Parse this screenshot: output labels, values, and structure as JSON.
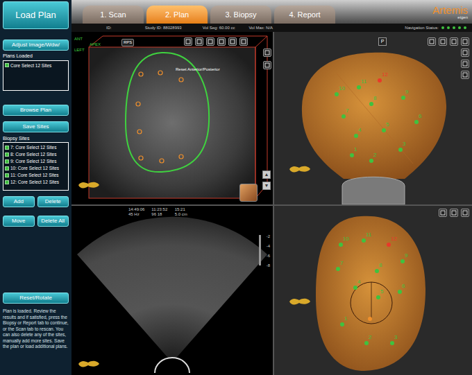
{
  "sidebar": {
    "load_button": "Load Plan",
    "adjust_button": "Adjust Image/Wdw/",
    "plans_label": "Plans Loaded",
    "plans": [
      {
        "label": "Core Select 12 Sites",
        "checked": true
      }
    ],
    "plan_buttons": [
      "Browse Plan",
      "Save Sites"
    ],
    "sites_label": "Biopsy Sites",
    "sites": [
      {
        "label": "7: Core Select 12 Sites",
        "checked": true
      },
      {
        "label": "8: Core Select 12 Sites",
        "checked": true
      },
      {
        "label": "9: Core Select 12 Sites",
        "checked": true
      },
      {
        "label": "10: Core Select 12 Sites",
        "checked": true
      },
      {
        "label": "11: Core Select 12 Sites",
        "checked": true
      },
      {
        "label": "12: Core Select 12 Sites",
        "checked": true
      }
    ],
    "site_buttons": [
      "Add",
      "Delete",
      "Move",
      "Delete All"
    ],
    "reset_button": "Reset/Rotate",
    "help_text": "Plan is loaded. Review the results and if satisfied, press the Biopsy or Report tab to continue, or the Scan tab to rescan. You can also delete any of the sites, manually add more sites. Save the plan or load additional plans."
  },
  "tabs": [
    {
      "label": "1. Scan",
      "selected": false
    },
    {
      "label": "2. Plan",
      "selected": true
    },
    {
      "label": "3. Biopsy",
      "selected": false
    },
    {
      "label": "4. Report",
      "selected": false
    }
  ],
  "logo": {
    "name": "Artemis",
    "sub": "eigen"
  },
  "info": {
    "id": "ID:",
    "study": "Study ID: 88028993",
    "vol_seg": "Vol Seg: 60.00 cc",
    "vol_max": "Vol Max: N/A",
    "nav_label": "Navigation Status:",
    "nav_dots": [
      {
        "on": true
      },
      {
        "on": true
      },
      {
        "on": true
      },
      {
        "on": true
      },
      {
        "on": true
      }
    ]
  },
  "scan_panel": {
    "orientation": [
      "ANT",
      "APEX",
      "LEFT"
    ],
    "overlay": "Reset Anterior/Posterior",
    "mode": "RPS",
    "arrows": [
      "▲",
      "▼"
    ]
  },
  "ultrasound": {
    "readout": [
      "14:49:06",
      "11:23:52",
      "15:21",
      "45 Hz",
      "96 18",
      "5.0 cm"
    ],
    "scale": [
      "-2",
      "-4",
      "-6",
      "-8"
    ]
  },
  "model_top": {
    "button": "P",
    "sites": [
      {
        "label": "1",
        "color": "#3fc23f"
      },
      {
        "label": "2",
        "color": "#3fc23f"
      },
      {
        "label": "3",
        "color": "#3fc23f"
      },
      {
        "label": "4",
        "color": "#3fc23f"
      },
      {
        "label": "5",
        "color": "#3fc23f"
      },
      {
        "label": "6",
        "color": "#3fc23f"
      },
      {
        "label": "7",
        "color": "#3fc23f"
      },
      {
        "label": "8",
        "color": "#3fc23f"
      },
      {
        "label": "9",
        "color": "#3fc23f"
      },
      {
        "label": "10",
        "color": "#3fc23f"
      },
      {
        "label": "11",
        "color": "#3fc23f"
      },
      {
        "label": "12",
        "color": "#e8392a"
      }
    ]
  },
  "model_bottom": {
    "sites": [
      {
        "label": "1",
        "color": "#3fc23f"
      },
      {
        "label": "2",
        "color": "#3fc23f"
      },
      {
        "label": "3",
        "color": "#3fc23f"
      },
      {
        "label": "4",
        "color": "#3fc23f"
      },
      {
        "label": "5",
        "color": "#3fc23f"
      },
      {
        "label": "6",
        "color": "#3fc23f"
      },
      {
        "label": "7",
        "color": "#3fc23f"
      },
      {
        "label": "8",
        "color": "#3fc23f"
      },
      {
        "label": "9",
        "color": "#3fc23f"
      },
      {
        "label": "10",
        "color": "#3fc23f"
      },
      {
        "label": "11",
        "color": "#3fc23f"
      },
      {
        "label": "12",
        "color": "#e8392a"
      }
    ]
  }
}
